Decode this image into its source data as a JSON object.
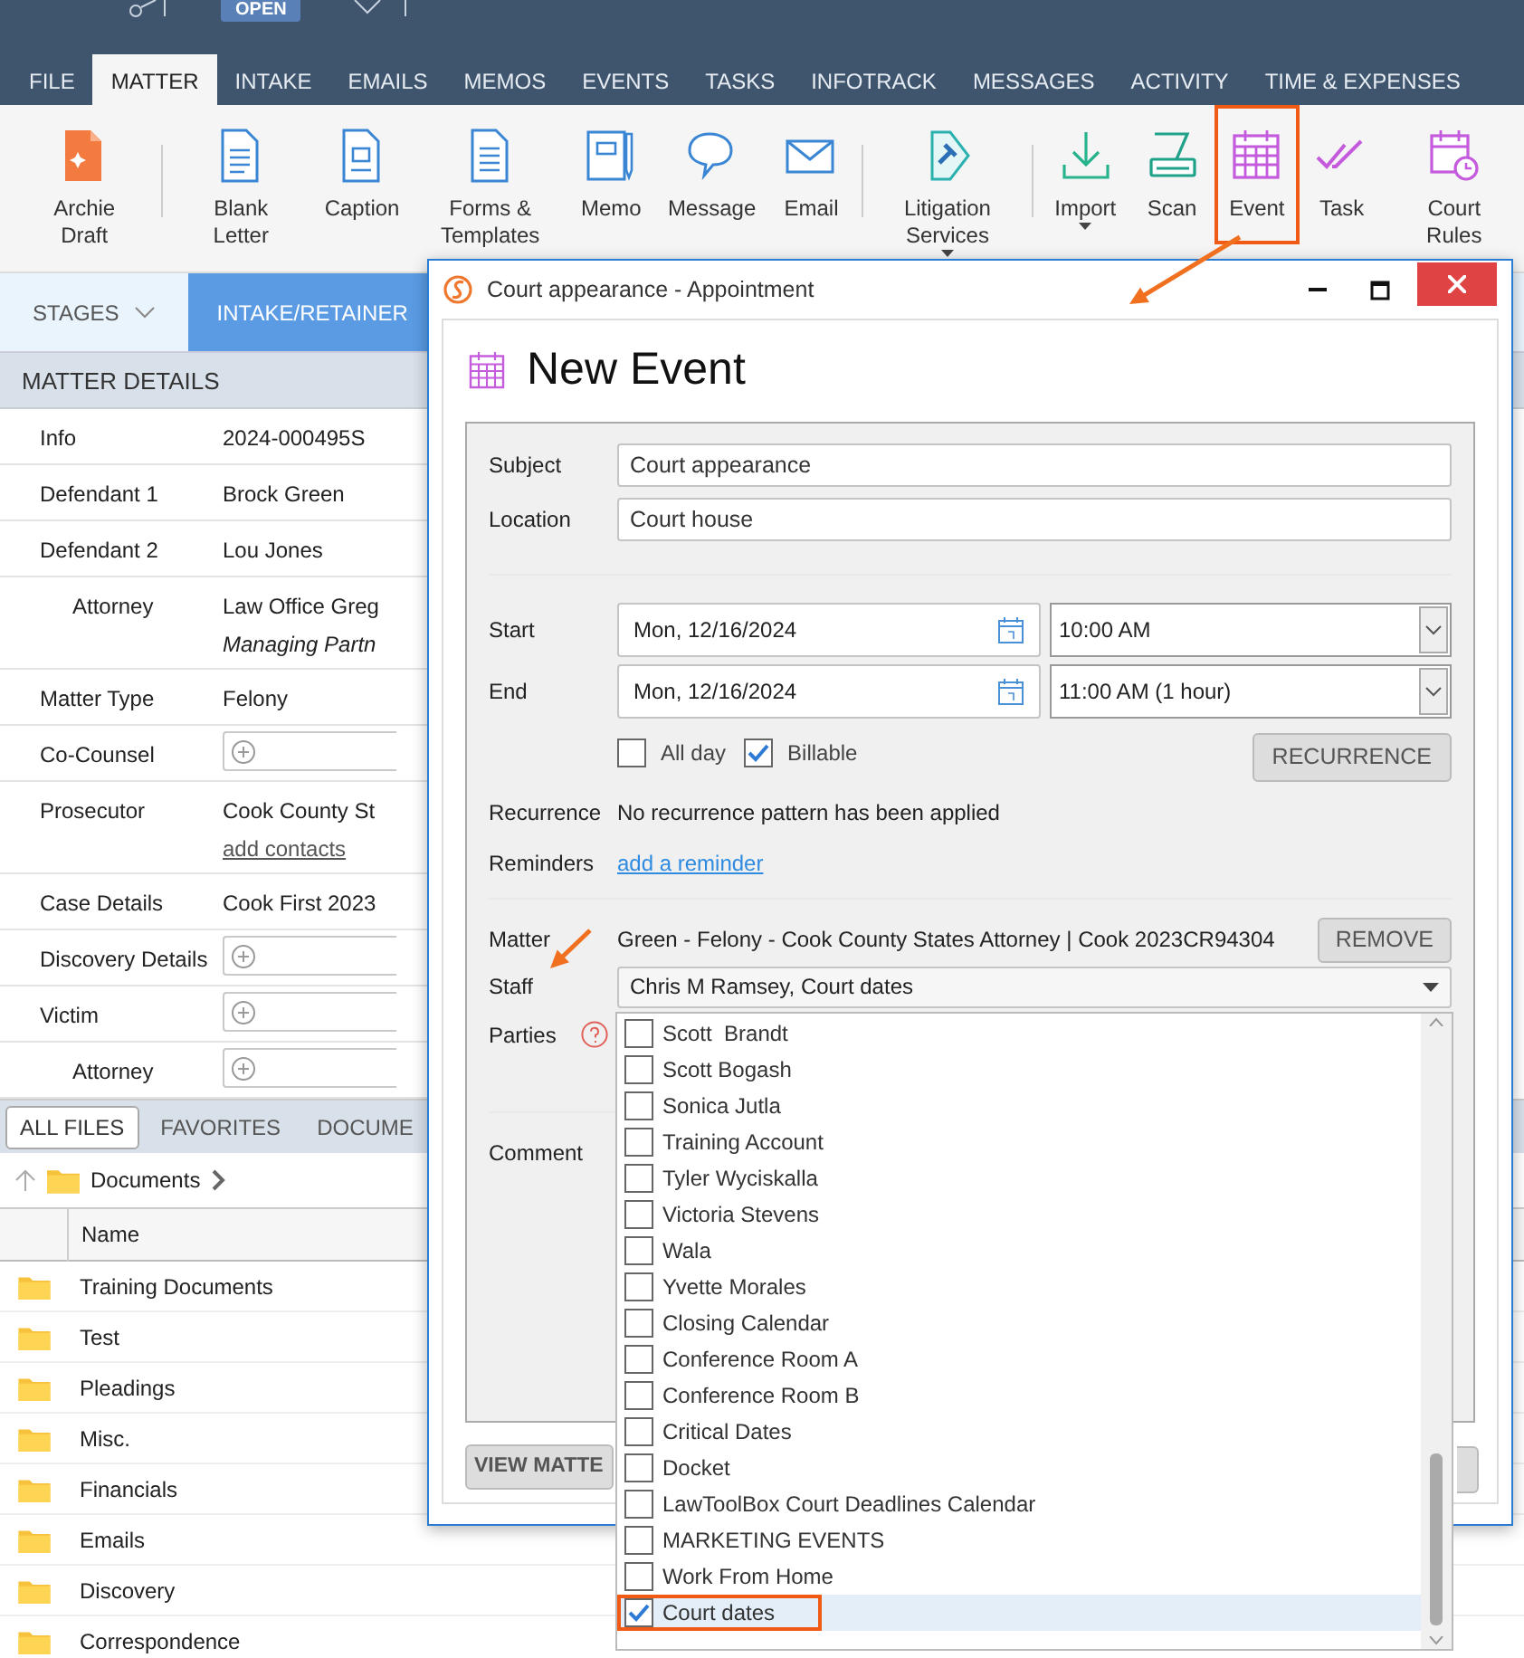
{
  "top_bar": {
    "status_badge": "OPEN"
  },
  "tabs": [
    {
      "label": "FILE",
      "selected": false
    },
    {
      "label": "MATTER",
      "selected": true
    },
    {
      "label": "INTAKE",
      "selected": false
    },
    {
      "label": "EMAILS",
      "selected": false
    },
    {
      "label": "MEMOS",
      "selected": false
    },
    {
      "label": "EVENTS",
      "selected": false
    },
    {
      "label": "TASKS",
      "selected": false
    },
    {
      "label": "INFOTRACK",
      "selected": false
    },
    {
      "label": "MESSAGES",
      "selected": false
    },
    {
      "label": "ACTIVITY",
      "selected": false
    },
    {
      "label": "TIME & EXPENSES",
      "selected": false
    }
  ],
  "ribbon": [
    {
      "kind": "draft",
      "label": "Archie Draft",
      "dropdown": false,
      "highlighted": false,
      "group_end": true
    },
    {
      "kind": "letter",
      "label": "Blank Letter",
      "dropdown": false,
      "highlighted": false,
      "group_end": false
    },
    {
      "kind": "caption",
      "label": "Caption",
      "dropdown": false,
      "highlighted": false,
      "group_end": false
    },
    {
      "kind": "forms",
      "label": "Forms & Templates",
      "dropdown": false,
      "highlighted": false,
      "group_end": false
    },
    {
      "kind": "memo",
      "label": "Memo",
      "dropdown": false,
      "highlighted": false,
      "group_end": false
    },
    {
      "kind": "message",
      "label": "Message",
      "dropdown": false,
      "highlighted": false,
      "group_end": false
    },
    {
      "kind": "email",
      "label": "Email",
      "dropdown": false,
      "highlighted": false,
      "group_end": true
    },
    {
      "kind": "litigation",
      "label": "Litigation Services",
      "dropdown": true,
      "highlighted": false,
      "group_end": true
    },
    {
      "kind": "import",
      "label": "Import",
      "dropdown": true,
      "highlighted": false,
      "group_end": false
    },
    {
      "kind": "scan",
      "label": "Scan",
      "dropdown": false,
      "highlighted": false,
      "group_end": false
    },
    {
      "kind": "event",
      "label": "Event",
      "dropdown": false,
      "highlighted": true,
      "group_end": false
    },
    {
      "kind": "task",
      "label": "Task",
      "dropdown": false,
      "highlighted": false,
      "group_end": false
    },
    {
      "kind": "rules",
      "label": "Court Rules",
      "dropdown": false,
      "highlighted": false,
      "group_end": false
    }
  ],
  "stages": {
    "label": "STAGES",
    "current": "INTAKE/RETAINER"
  },
  "matter_details": {
    "title": "MATTER DETAILS",
    "rows": [
      {
        "label": "Info",
        "indent": false,
        "kind": "text",
        "value": "2024-000495S"
      },
      {
        "label": "Defendant 1",
        "indent": false,
        "kind": "text",
        "value": "Brock Green"
      },
      {
        "label": "Defendant 2",
        "indent": false,
        "kind": "text",
        "value": "Lou Jones"
      },
      {
        "label": "Attorney",
        "indent": true,
        "kind": "text",
        "value": "Law Office Greg",
        "subtitle": "Managing Partn"
      },
      {
        "label": "Matter Type",
        "indent": false,
        "kind": "text",
        "value": "Felony"
      },
      {
        "label": "Co-Counsel",
        "indent": false,
        "kind": "add"
      },
      {
        "label": "Prosecutor",
        "indent": false,
        "kind": "text",
        "value": "Cook County St",
        "link": "add contacts"
      },
      {
        "label": "Case Details",
        "indent": false,
        "kind": "text",
        "value": "Cook First 2023"
      },
      {
        "label": "Discovery Details",
        "indent": false,
        "kind": "add"
      },
      {
        "label": "Victim",
        "indent": false,
        "kind": "add"
      },
      {
        "label": "Attorney",
        "indent": true,
        "kind": "add"
      }
    ]
  },
  "files": {
    "tabs": [
      {
        "label": "ALL FILES",
        "selected": true
      },
      {
        "label": "FAVORITES",
        "selected": false
      },
      {
        "label": "DOCUME",
        "selected": false
      }
    ],
    "breadcrumb": "Documents",
    "columns": [
      "Name"
    ],
    "rows": [
      "Training Documents",
      "Test",
      "Pleadings",
      "Misc.",
      "Financials",
      "Emails",
      "Discovery",
      "Correspondence"
    ]
  },
  "dialog": {
    "title": "Court appearance - Appointment",
    "heading": "New Event",
    "subject_label": "Subject",
    "subject": "Court appearance",
    "location_label": "Location",
    "location": "Court house",
    "start_label": "Start",
    "start_date": "Mon, 12/16/2024",
    "start_time": "10:00 AM",
    "end_label": "End",
    "end_date": "Mon, 12/16/2024",
    "end_time": "11:00 AM (1 hour)",
    "all_day": {
      "label": "All day",
      "checked": false
    },
    "billable": {
      "label": "Billable",
      "checked": true
    },
    "recurrence_button": "RECURRENCE",
    "recurrence_label": "Recurrence",
    "recurrence_text": "No recurrence pattern has been applied",
    "reminders_label": "Reminders",
    "reminders_link": "add a reminder",
    "matter_label": "Matter",
    "matter_text": "Green - Felony - Cook County States Attorney | Cook 2023CR94304",
    "remove_button": "REMOVE",
    "staff_label": "Staff",
    "staff_value": "Chris M Ramsey, Court dates",
    "parties_label": "Parties",
    "comment_label": "Comment",
    "view_matter_button": "VIEW MATTE"
  },
  "staff_dropdown": {
    "items": [
      {
        "label": "Scott  Brandt",
        "checked": false,
        "selected": false,
        "highlighted": false
      },
      {
        "label": "Scott Bogash",
        "checked": false,
        "selected": false,
        "highlighted": false
      },
      {
        "label": "Sonica Jutla",
        "checked": false,
        "selected": false,
        "highlighted": false
      },
      {
        "label": "Training Account",
        "checked": false,
        "selected": false,
        "highlighted": false
      },
      {
        "label": "Tyler Wyciskalla",
        "checked": false,
        "selected": false,
        "highlighted": false
      },
      {
        "label": "Victoria Stevens",
        "checked": false,
        "selected": false,
        "highlighted": false
      },
      {
        "label": "Wala",
        "checked": false,
        "selected": false,
        "highlighted": false
      },
      {
        "label": "Yvette Morales",
        "checked": false,
        "selected": false,
        "highlighted": false
      },
      {
        "label": "Closing Calendar",
        "checked": false,
        "selected": false,
        "highlighted": false
      },
      {
        "label": "Conference Room A",
        "checked": false,
        "selected": false,
        "highlighted": false
      },
      {
        "label": "Conference Room B",
        "checked": false,
        "selected": false,
        "highlighted": false
      },
      {
        "label": "Critical Dates",
        "checked": false,
        "selected": false,
        "highlighted": false
      },
      {
        "label": "Docket",
        "checked": false,
        "selected": false,
        "highlighted": false
      },
      {
        "label": "LawToolBox Court Deadlines Calendar",
        "checked": false,
        "selected": false,
        "highlighted": false
      },
      {
        "label": "MARKETING EVENTS",
        "checked": false,
        "selected": false,
        "highlighted": false
      },
      {
        "label": "Work From Home",
        "checked": false,
        "selected": false,
        "highlighted": false
      },
      {
        "label": "Court dates",
        "checked": true,
        "selected": true,
        "highlighted": true
      }
    ]
  }
}
